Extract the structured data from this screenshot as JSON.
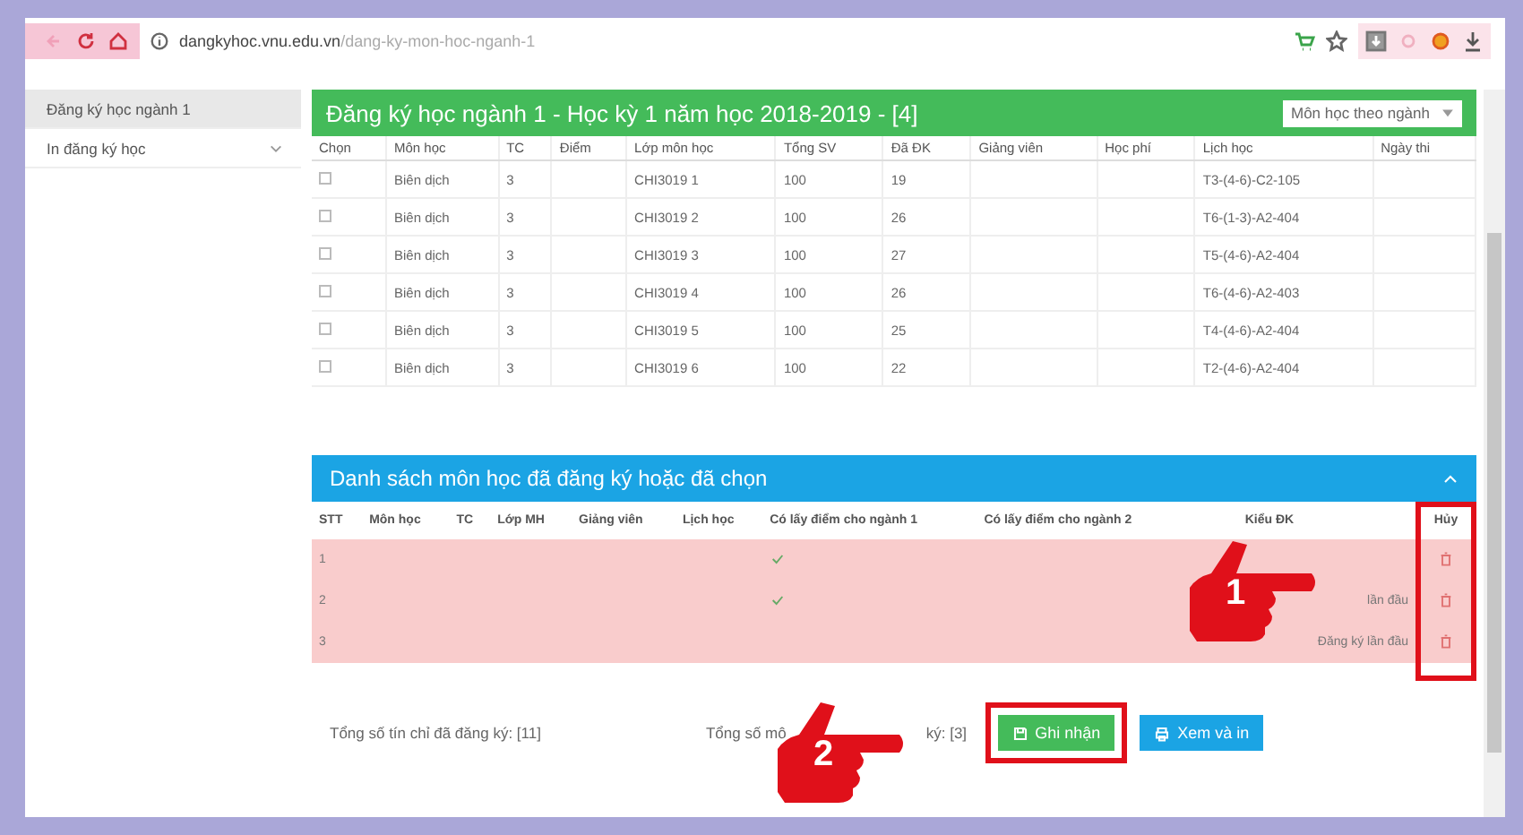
{
  "browser": {
    "url_host": "dangkyhoc.vnu.edu.vn",
    "url_path": "/dang-ky-mon-hoc-nganh-1"
  },
  "sidebar": {
    "items": [
      {
        "label": "Đăng ký học ngành 1",
        "selected": true,
        "kind": "link"
      },
      {
        "label": "In đăng ký học",
        "selected": false,
        "kind": "dropdown"
      }
    ]
  },
  "course_panel": {
    "title": "Đăng ký học ngành 1 - Học kỳ 1 năm học 2018-2019 - [4]",
    "filter": "Môn học theo ngành",
    "columns": [
      "Chọn",
      "Môn học",
      "TC",
      "Điểm",
      "Lớp môn học",
      "Tổng SV",
      "Đã ĐK",
      "Giảng viên",
      "Học phí",
      "Lịch học",
      "Ngày thi"
    ],
    "rows": [
      {
        "checked": false,
        "subject": "Biên dịch",
        "credits": "3",
        "class": "CHI3019 1",
        "total": "100",
        "registered": "19",
        "schedule": "T3-(4-6)-C2-105"
      },
      {
        "checked": false,
        "subject": "Biên dịch",
        "credits": "3",
        "class": "CHI3019 2",
        "total": "100",
        "registered": "26",
        "schedule": "T6-(1-3)-A2-404"
      },
      {
        "checked": false,
        "subject": "Biên dịch",
        "credits": "3",
        "class": "CHI3019 3",
        "total": "100",
        "registered": "27",
        "schedule": "T5-(4-6)-A2-404"
      },
      {
        "checked": false,
        "subject": "Biên dịch",
        "credits": "3",
        "class": "CHI3019 4",
        "total": "100",
        "registered": "26",
        "schedule": "T6-(4-6)-A2-403"
      },
      {
        "checked": false,
        "subject": "Biên dịch",
        "credits": "3",
        "class": "CHI3019 5",
        "total": "100",
        "registered": "25",
        "schedule": "T4-(4-6)-A2-404"
      },
      {
        "checked": false,
        "subject": "Biên dịch",
        "credits": "3",
        "class": "CHI3019 6",
        "total": "100",
        "registered": "22",
        "schedule": "T2-(4-6)-A2-404"
      }
    ]
  },
  "selected_panel": {
    "title": "Danh sách môn học đã đăng ký hoặc đã chọn",
    "columns": [
      "STT",
      "Môn học",
      "TC",
      "Lớp MH",
      "Giảng viên",
      "Lịch học",
      "Có lấy điểm cho ngành 1",
      "Có lấy điểm cho ngành 2",
      "Kiểu ĐK",
      "Hủy"
    ],
    "rows": [
      {
        "index": "1",
        "major1": true,
        "major2": false
      },
      {
        "index": "2",
        "major1": true,
        "major2": false,
        "type": "lần đầu"
      },
      {
        "index": "3",
        "major1": false,
        "major2": false,
        "type": "Đăng ký lần đầu"
      }
    ]
  },
  "footer": {
    "total_credits": "Tổng số tín chỉ đã đăng ký: [11]",
    "total_subjects_start": "Tổng số mô",
    "total_subjects_end": "ký: [3]",
    "buttons": [
      {
        "label": "Ghi nhận",
        "kind": "save",
        "highlighted": true
      },
      {
        "label": "Xem và in",
        "kind": "print",
        "highlighted": false
      }
    ]
  },
  "annotations": [
    {
      "number": "1"
    },
    {
      "number": "2"
    }
  ]
}
